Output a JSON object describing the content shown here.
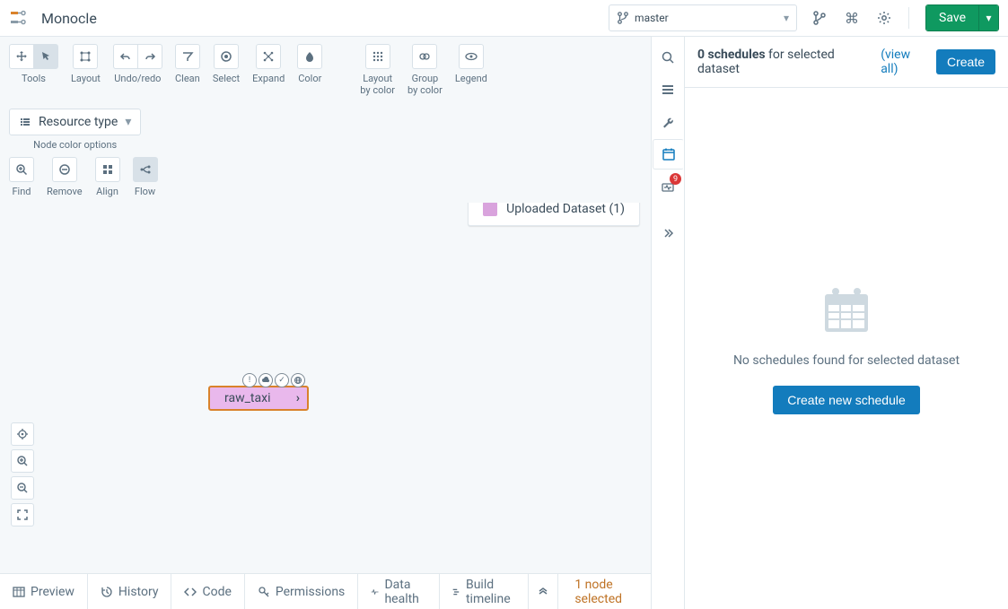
{
  "header": {
    "app_title": "Monocle",
    "branch": "master",
    "save_label": "Save"
  },
  "toolbar": {
    "tools": "Tools",
    "layout": "Layout",
    "undo": "Undo/redo",
    "clean": "Clean",
    "select": "Select",
    "expand": "Expand",
    "color": "Color",
    "layout_by_color": "Layout\nby color",
    "group_by_color": "Group\nby color",
    "legend": "Legend",
    "node_color": "Node color options",
    "resource_type": "Resource type",
    "find": "Find",
    "remove": "Remove",
    "align": "Align",
    "flow": "Flow"
  },
  "legend": {
    "label": "Uploaded Dataset (1)"
  },
  "node": {
    "label": "raw_taxi"
  },
  "midrail": {
    "badge": "9"
  },
  "right_panel": {
    "count_bold": "0 schedules",
    "count_rest": " for selected dataset ",
    "view_all": "(view all)",
    "create": "Create",
    "empty_msg": "No schedules found for selected dataset",
    "create_new": "Create new schedule"
  },
  "bottom": {
    "preview": "Preview",
    "history": "History",
    "code": "Code",
    "permissions": "Permissions",
    "data_health": "Data health",
    "build_timeline": "Build timeline",
    "selected": "1 node selected"
  }
}
